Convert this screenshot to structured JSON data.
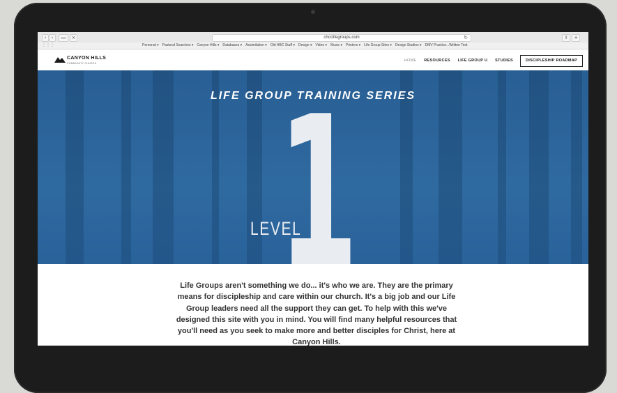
{
  "browser": {
    "nav_back": "‹",
    "nav_forward": "›",
    "sidebar_btn": "▭",
    "close_btn": "×",
    "url": "chcclifegroups.com",
    "reload": "↻",
    "share": "⇪",
    "bookmarks": [
      "Personal ▾",
      "Pastoral Searches ▾",
      "Canyon Hills ▾",
      "Databases ▾",
      "Assimilation ▾",
      "Old HBC Stuff ▾",
      "Design ▾",
      "Video ▾",
      "Music ▾",
      "Printers ▾",
      "Life Group Sites ▾",
      "Design Studios ▾",
      "DMV Practice...Written Test"
    ]
  },
  "site": {
    "logo_name": "CANYON HILLS",
    "logo_sub": "COMMUNITY CHURCH",
    "nav": {
      "home": "HOME",
      "resources": "RESOURCES",
      "life_group_u": "LIFE GROUP U",
      "studies": "STUDIES",
      "cta": "DISCIPLESHIP ROADMAP"
    }
  },
  "hero": {
    "title": "LIFE GROUP TRAINING SERIES",
    "number": "1",
    "level": "LEVEL"
  },
  "intro": {
    "text": "Life Groups aren't something we do... it's who we are. They are the primary means for discipleship and care within our church.  It's a big job and our Life Group leaders need all the support they can get. To help with this we've designed this site with you in mind. You will find many helpful resources that you'll need as you seek to make more and better disciples for Christ, here at Canyon Hills."
  },
  "colors": {
    "hero_blue": "#2f6aa0",
    "bezel": "#1c1c1c"
  }
}
